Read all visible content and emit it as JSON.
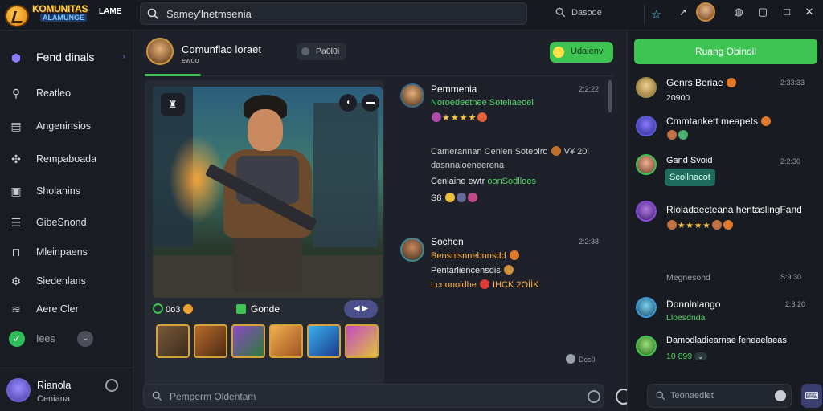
{
  "app": {
    "logo_line1": "KOMUNITAS",
    "logo_line2": "ALAMUNGE",
    "logo_line3": "LAME"
  },
  "topbar": {
    "search_text": "Samey'lnetmsenia",
    "search_small_text": "Dasode",
    "icons": [
      "search-icon",
      "star-icon",
      "send-icon",
      "discord-icon",
      "minimize-icon",
      "maximize-icon",
      "close-icon"
    ]
  },
  "sidebar": {
    "items": [
      {
        "label": "Fend dinals",
        "icon": "shield-icon"
      },
      {
        "label": "Reatleo",
        "icon": "search-icon"
      },
      {
        "label": "Angeninsios",
        "icon": "chart-icon"
      },
      {
        "label": "Rempaboada",
        "icon": "puzzle-icon"
      },
      {
        "label": "Sholanins",
        "icon": "calendar-icon"
      },
      {
        "label": "GibeSnond",
        "icon": "stack-icon"
      },
      {
        "label": "Mleinpaens",
        "icon": "lock-icon"
      },
      {
        "label": "Siedenlans",
        "icon": "gear-icon"
      },
      {
        "label": "Aere Cler",
        "icon": "layers-icon"
      },
      {
        "label": "Iees",
        "icon": "check-icon"
      }
    ],
    "user": {
      "name": "Rianola",
      "sub": "Ceniana"
    }
  },
  "main": {
    "channel_title": "Comunflao loraet",
    "channel_sub": "ewoo",
    "pill_text": "Pa0l0i",
    "green_pill_text": "Udaienv",
    "reactions": {
      "left": "0o3",
      "middle": "Gonde"
    },
    "composer_placeholder": "Pemperm Oldentam",
    "scroll_info": "Dcs0",
    "messages": [
      {
        "name": "Pemmenia",
        "time": "2:2:22",
        "lines": [
          {
            "text": "Noroedeetnee Sotelıaeoel",
            "color": "green"
          },
          {
            "text": "Camerannan Cenlen Sotebiro",
            "color": "grey"
          },
          {
            "text": "dasnnaloeneerena",
            "color": "grey"
          },
          {
            "text": "Cenlaino ewtr",
            "color": "white"
          },
          {
            "text": "oonSodlloes",
            "color": "green"
          },
          {
            "text": "S8",
            "color": "white"
          },
          {
            "text": "V¥ 20i",
            "color": "grey"
          }
        ]
      },
      {
        "name": "Sochen",
        "time": "2:2:38",
        "lines": [
          {
            "text": "Bensnlsnnebnnsdd",
            "color": "orange"
          },
          {
            "text": "Pentarliencensdis",
            "color": "white"
          },
          {
            "text": "Lcnonoidhe",
            "color": "orange"
          },
          {
            "text": "IHCK 2OİİK",
            "color": "orange"
          }
        ]
      }
    ]
  },
  "right": {
    "join_label": "Ruang Obinoil",
    "section_label": "Megnesohd",
    "section_time": "S:9:30",
    "search_text": "Teonaedlet",
    "entries": [
      {
        "name": "Genrs Beriae",
        "time": "2:33:33",
        "line": "20900"
      },
      {
        "name": "Cmmtankett meapets",
        "time": ""
      },
      {
        "name": "Gand Svoid",
        "time": "2:2:30",
        "pill": "Scollnacot"
      },
      {
        "name": "Rioladaecteana hentaslingFand",
        "time": ""
      },
      {
        "name": "Donnlnlango",
        "time": "2:3:20",
        "line": "Lloesdnda"
      },
      {
        "name": "Damodladiearnae feneaelaeas",
        "time": "",
        "line": "10 899"
      }
    ]
  },
  "colors": {
    "accent_green": "#3ec452",
    "accent_purple": "#8c7cff",
    "background": "#1b1f27"
  }
}
